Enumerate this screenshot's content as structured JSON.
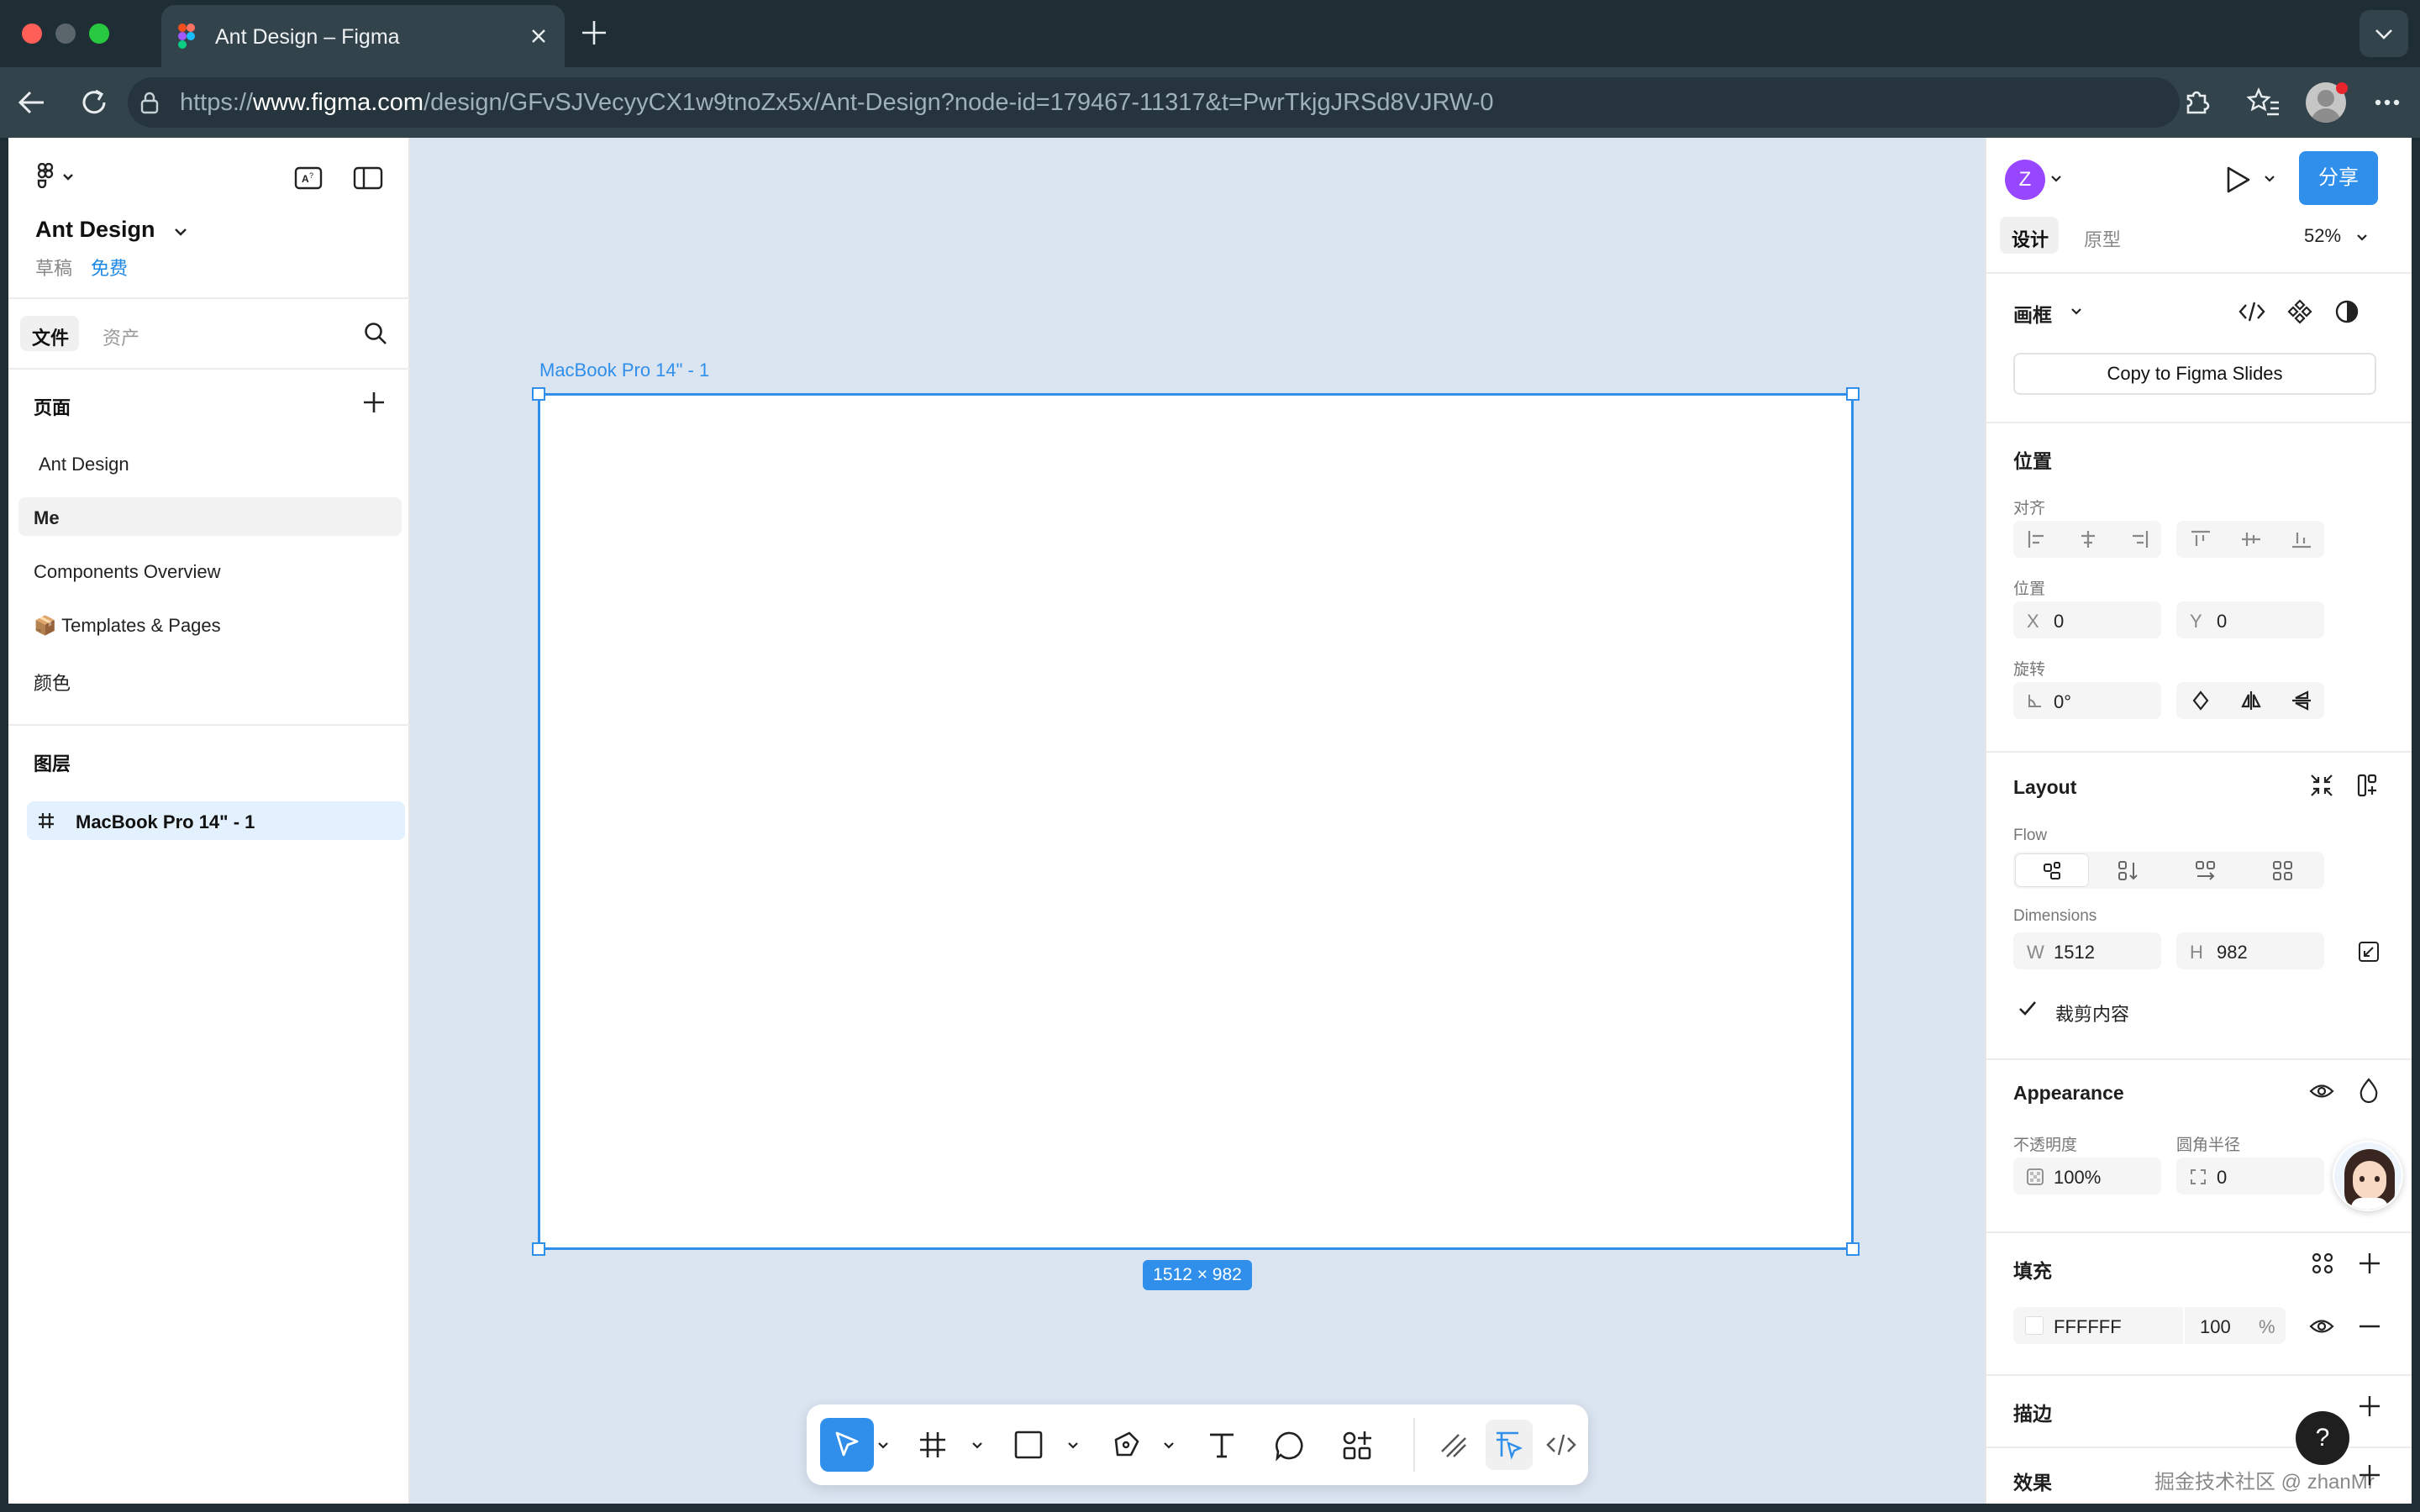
{
  "browser": {
    "tab_title": "Ant Design – Figma",
    "url": {
      "scheme": "https://",
      "host": "www.figma.com",
      "path": "/design/GFvSJVecyyCX1w9tnoZx5x/Ant-Design?node-id=179467-11317&t=PwrTkjgJRSd8VJRW-0"
    }
  },
  "file": {
    "name": "Ant Design",
    "draft": "草稿",
    "plan": "免费"
  },
  "left_tabs": {
    "files": "文件",
    "assets": "资产"
  },
  "pages": {
    "title": "页面",
    "items": [
      {
        "label": "Ant Design"
      },
      {
        "label": "Me"
      },
      {
        "label": "Components Overview"
      },
      {
        "label": "📦 Templates & Pages"
      },
      {
        "label": "颜色"
      }
    ]
  },
  "layers": {
    "title": "图层",
    "items": [
      {
        "label": "MacBook Pro 14\" - 1"
      }
    ]
  },
  "canvas": {
    "frame_label": "MacBook Pro 14\" - 1",
    "size_badge": "1512 × 982"
  },
  "right": {
    "avatar": "Z",
    "share": "分享",
    "tabs": {
      "design": "设计",
      "prototype": "原型"
    },
    "zoom": "52%",
    "frame_title": "画框",
    "copy_slides": "Copy to Figma Slides",
    "position": {
      "title": "位置",
      "align_label": "对齐",
      "pos_label": "位置",
      "x_key": "X",
      "x": "0",
      "y_key": "Y",
      "y": "0",
      "rotation_label": "旋转",
      "rotation": "0°"
    },
    "layout": {
      "title": "Layout",
      "flow_label": "Flow",
      "dimensions_label": "Dimensions",
      "w_key": "W",
      "w": "1512",
      "h_key": "H",
      "h": "982",
      "clip_label": "裁剪内容"
    },
    "appearance": {
      "title": "Appearance",
      "opacity_label": "不透明度",
      "opacity": "100%",
      "radius_label": "圆角半径",
      "radius": "0"
    },
    "fill": {
      "title": "填充",
      "hex": "FFFFFF",
      "percent": "100",
      "percent_sign": "%"
    },
    "stroke": {
      "title": "描边"
    },
    "effects": {
      "title": "效果"
    }
  },
  "help": "?",
  "watermark": "掘金技术社区 @ zhanMr",
  "colors": {
    "accent": "#2f8fea",
    "canvas": "#dbe5f2",
    "chrome": "#1f2d35"
  }
}
